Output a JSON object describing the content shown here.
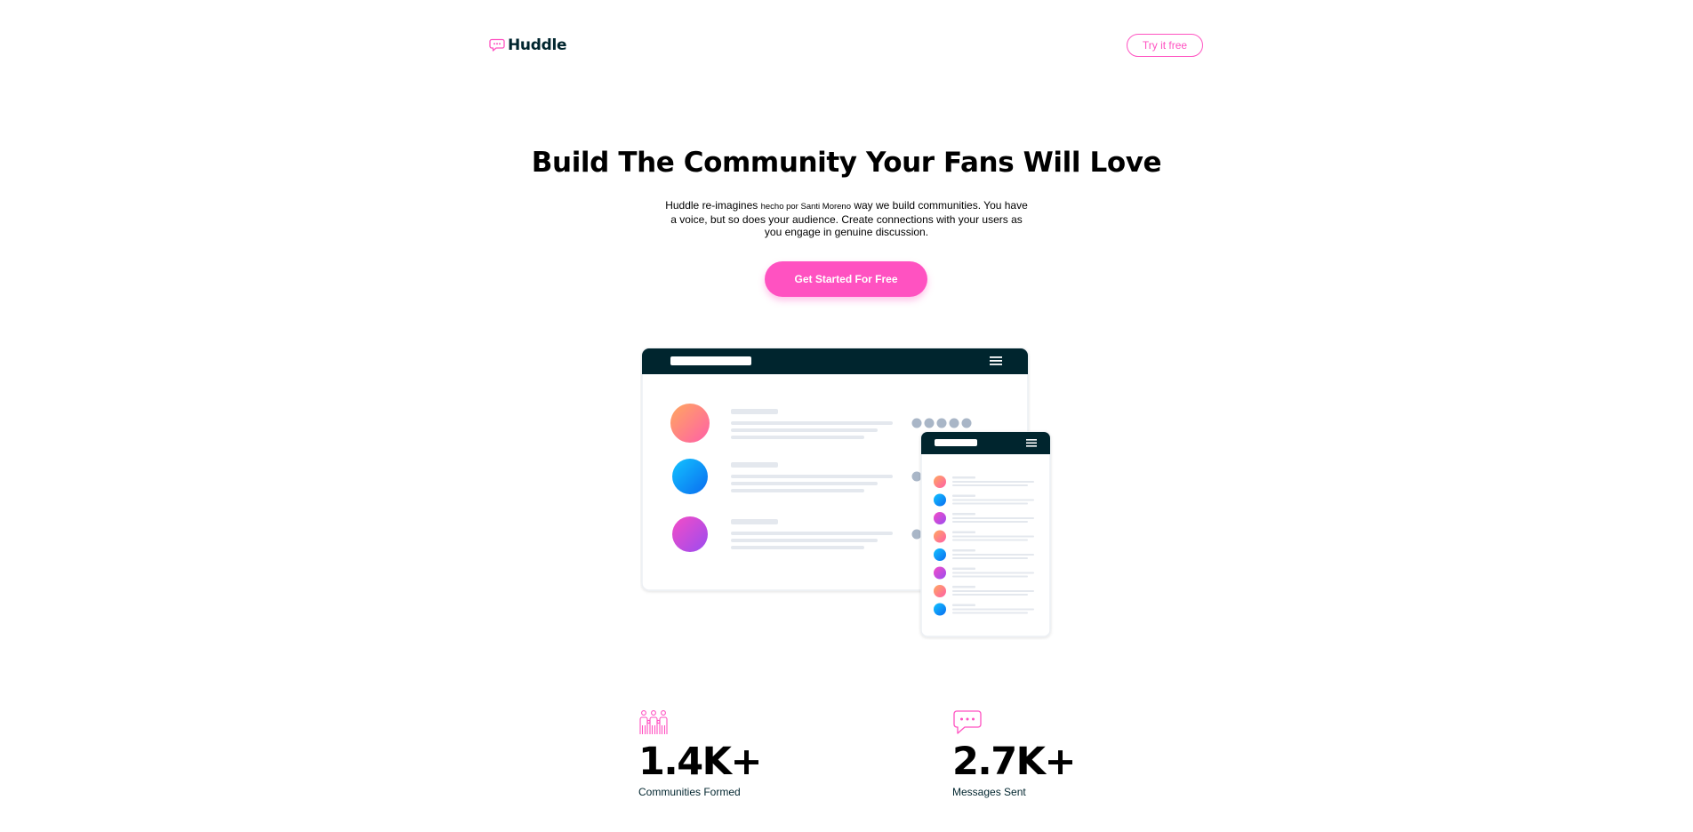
{
  "header": {
    "logo_text": "Huddle",
    "try_button": "Try it free"
  },
  "hero": {
    "title": "Build The Community Your Fans Will Love",
    "desc_part1": "Huddle re-imagines ",
    "desc_small": "hecho por Santi Moreno",
    "desc_part2": " way we build communities. You have a voice, but so does your audience. Create connections with your users as you engage in genuine discussion.",
    "cta_label": "Get Started For Free"
  },
  "stats": [
    {
      "icon": "communities-icon",
      "value": "1.4K+",
      "label": "Communities Formed"
    },
    {
      "icon": "messages-icon",
      "value": "2.7K+",
      "label": "Messages Sent"
    }
  ],
  "colors": {
    "accent": "#ff52c1",
    "dark": "#00252e",
    "placeholder": "#e4e8ee",
    "dot": "#a9b6c7"
  }
}
